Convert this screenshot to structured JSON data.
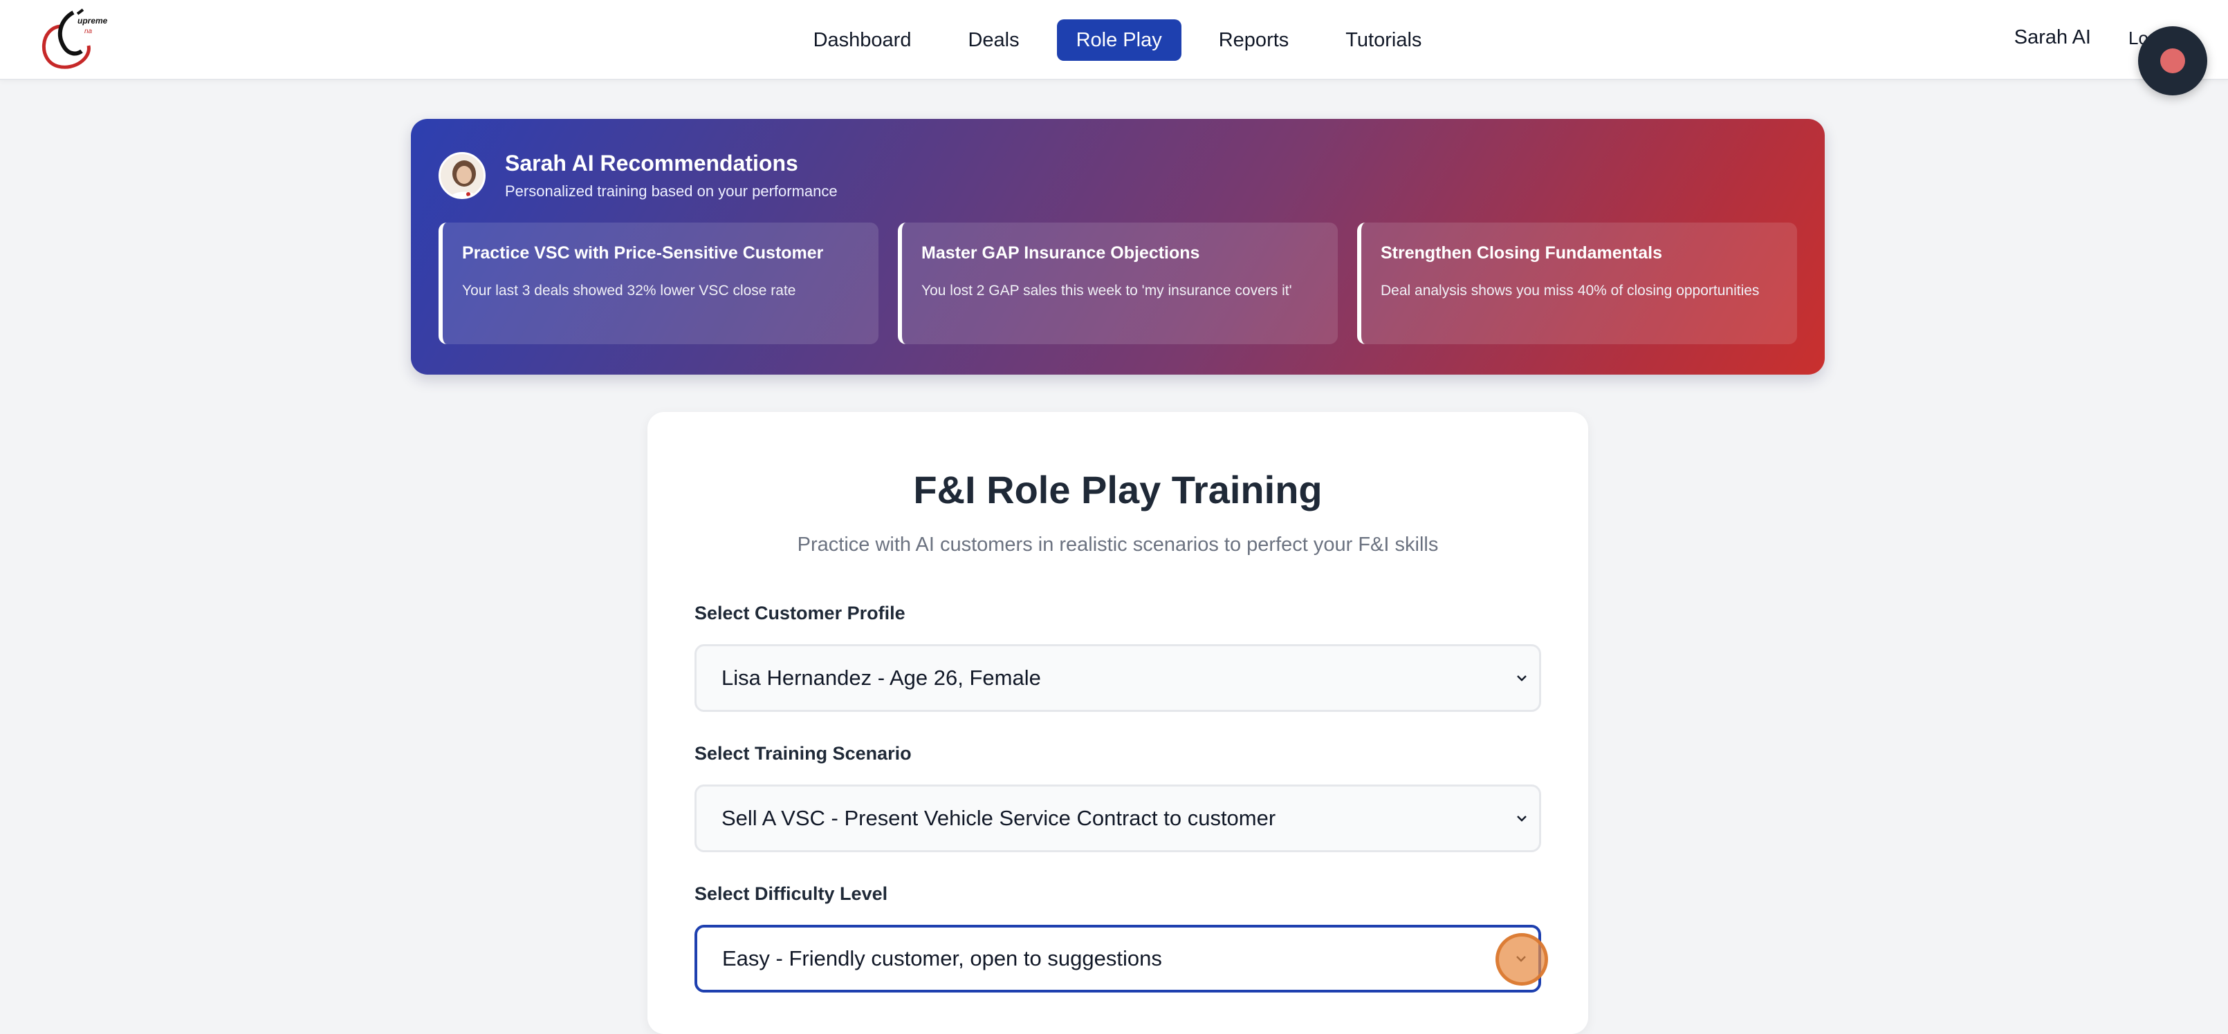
{
  "nav": {
    "items": [
      {
        "label": "Dashboard",
        "active": false
      },
      {
        "label": "Deals",
        "active": false
      },
      {
        "label": "Role Play",
        "active": true
      },
      {
        "label": "Reports",
        "active": false
      },
      {
        "label": "Tutorials",
        "active": false
      }
    ],
    "user_name": "Sarah AI",
    "logout_label": "Logout"
  },
  "recommendations": {
    "title": "Sarah AI Recommendations",
    "subtitle": "Personalized training based on your performance",
    "cards": [
      {
        "title": "Practice VSC with Price-Sensitive Customer",
        "description": "Your last 3 deals showed 32% lower VSC close rate"
      },
      {
        "title": "Master GAP Insurance Objections",
        "description": "You lost 2 GAP sales this week to 'my insurance covers it'"
      },
      {
        "title": "Strengthen Closing Fundamentals",
        "description": "Deal analysis shows you miss 40% of closing opportunities"
      }
    ]
  },
  "training": {
    "title": "F&I Role Play Training",
    "subtitle": "Practice with AI customers in realistic scenarios to perfect your F&I skills",
    "customer_label": "Select Customer Profile",
    "customer_value": "Lisa Hernandez - Age 26, Female",
    "scenario_label": "Select Training Scenario",
    "scenario_value": "Sell A VSC - Present Vehicle Service Contract to customer",
    "difficulty_label": "Select Difficulty Level",
    "difficulty_value": "Easy - Friendly customer, open to suggestions"
  },
  "colors": {
    "accent": "#1e40af",
    "banner_start": "#2d3fb0",
    "banner_end": "#c9302e",
    "record_button": "#1f2937"
  },
  "icons": [
    "logo-icon",
    "avatar-icon",
    "chevron-down-icon",
    "record-icon"
  ]
}
